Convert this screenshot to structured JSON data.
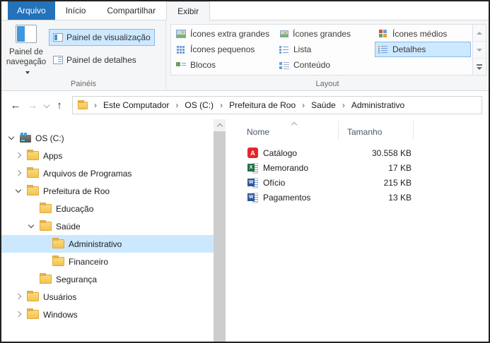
{
  "colors": {
    "file_tab_blue": "#2372ba",
    "selection_fill": "#cce8ff",
    "selection_border": "#84bdea",
    "folder_yellow": "#f3c44f"
  },
  "ribbon_tabs": [
    {
      "label": "Arquivo",
      "active": false
    },
    {
      "label": "Início",
      "active": false
    },
    {
      "label": "Compartilhar",
      "active": false
    },
    {
      "label": "Exibir",
      "active": true
    }
  ],
  "panels_group": {
    "label": "Painéis",
    "nav_button": {
      "label": "Painel de navegação",
      "icon": "navigation-pane-icon",
      "has_dropdown": true
    },
    "buttons": [
      {
        "label": "Painel de visualização",
        "icon": "preview-pane-icon",
        "selected": true
      },
      {
        "label": "Painel de detalhes",
        "icon": "details-pane-icon",
        "selected": false
      }
    ]
  },
  "layout_group": {
    "label": "Layout",
    "items": [
      {
        "label": "Ícones extra grandes",
        "icon": "extra-large-icons-icon",
        "selected": false
      },
      {
        "label": "Ícones grandes",
        "icon": "large-icons-icon",
        "selected": false
      },
      {
        "label": "Ícones médios",
        "icon": "medium-icons-icon",
        "selected": false
      },
      {
        "label": "Ícones pequenos",
        "icon": "small-icons-icon",
        "selected": false
      },
      {
        "label": "Lista",
        "icon": "list-view-icon",
        "selected": false
      },
      {
        "label": "Detalhes",
        "icon": "details-view-icon",
        "selected": true
      },
      {
        "label": "Blocos",
        "icon": "tiles-view-icon",
        "selected": false
      },
      {
        "label": "Conteúdo",
        "icon": "content-view-icon",
        "selected": false
      }
    ]
  },
  "address_bar": {
    "separator": "›",
    "icons": [
      "back-arrow-icon",
      "forward-arrow-icon",
      "recent-locations-chevron-icon",
      "up-arrow-icon",
      "folder-icon"
    ],
    "back": "←",
    "forward": "→",
    "up": "↑",
    "breadcrumb": [
      "Este Computador",
      "OS (C:)",
      "Prefeitura de Roo",
      "Saúde",
      "Administrativo"
    ]
  },
  "tree": {
    "items": [
      {
        "label": "OS (C:)",
        "level": 0,
        "expander": "expanded",
        "icon": "drive-icon",
        "selected": false
      },
      {
        "label": "Apps",
        "level": 1,
        "expander": "collapsed",
        "icon": "folder-icon",
        "selected": false
      },
      {
        "label": "Arquivos de Programas",
        "level": 1,
        "expander": "collapsed",
        "icon": "folder-icon",
        "selected": false
      },
      {
        "label": "Prefeitura de Roo",
        "level": 1,
        "expander": "expanded",
        "icon": "folder-icon",
        "selected": false
      },
      {
        "label": "Educação",
        "level": 2,
        "expander": "none",
        "icon": "folder-icon",
        "selected": false
      },
      {
        "label": "Saúde",
        "level": 2,
        "expander": "expanded",
        "icon": "folder-icon",
        "selected": false
      },
      {
        "label": "Administrativo",
        "level": 3,
        "expander": "none",
        "icon": "folder-icon",
        "selected": true
      },
      {
        "label": "Financeiro",
        "level": 3,
        "expander": "none",
        "icon": "folder-icon",
        "selected": false
      },
      {
        "label": "Segurança",
        "level": 2,
        "expander": "none",
        "icon": "folder-icon",
        "selected": false
      },
      {
        "label": "Usuários",
        "level": 1,
        "expander": "collapsed",
        "icon": "folder-icon",
        "selected": false
      },
      {
        "label": "Windows",
        "level": 1,
        "expander": "collapsed",
        "icon": "folder-icon",
        "selected": false
      }
    ]
  },
  "file_list": {
    "columns": [
      "Nome",
      "Tamanho"
    ],
    "sort": {
      "column": "Nome",
      "direction": "asc"
    },
    "files": [
      {
        "name": "Catálogo",
        "size": "30.558 KB",
        "icon": "pdf-file-icon"
      },
      {
        "name": "Memorando",
        "size": "17 KB",
        "icon": "excel-file-icon"
      },
      {
        "name": "Ofício",
        "size": "215 KB",
        "icon": "word-file-icon"
      },
      {
        "name": "Pagamentos",
        "size": "13 KB",
        "icon": "word-file-icon"
      }
    ]
  }
}
